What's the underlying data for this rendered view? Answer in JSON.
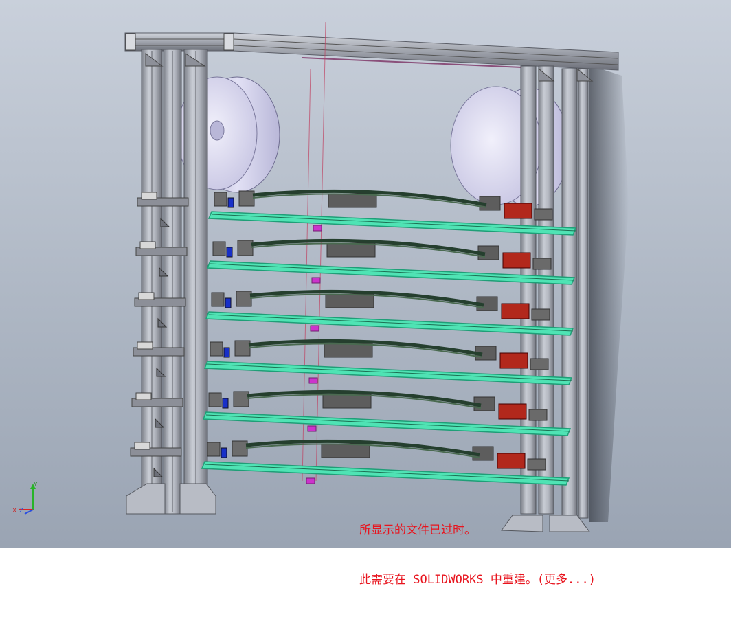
{
  "viewport": {
    "background_top": "#c9d0db",
    "background_bottom": "#9aa4b3"
  },
  "model": {
    "frame_color": "#a9adb6",
    "frame_dark": "#6d7079",
    "roller_color": "#d7d6ee",
    "roller_shade": "#a6a4c7",
    "tray_color": "#4fe3b4",
    "tray_edge": "#1f9e77",
    "block_red": "#b2281c",
    "block_blue": "#1830c8",
    "marker_magenta": "#cc33cc",
    "fixture_gray": "#6c6c6c",
    "centerline_color": "#c04060",
    "tray_count": 6
  },
  "triad": {
    "x_label": "X",
    "y_label": "Y",
    "z_label": "Z"
  },
  "notice": {
    "line1": "所显示的文件已过时。",
    "line2": "此需要在 SOLIDWORKS 中重建。(更多...)",
    "color": "#e8141e"
  }
}
